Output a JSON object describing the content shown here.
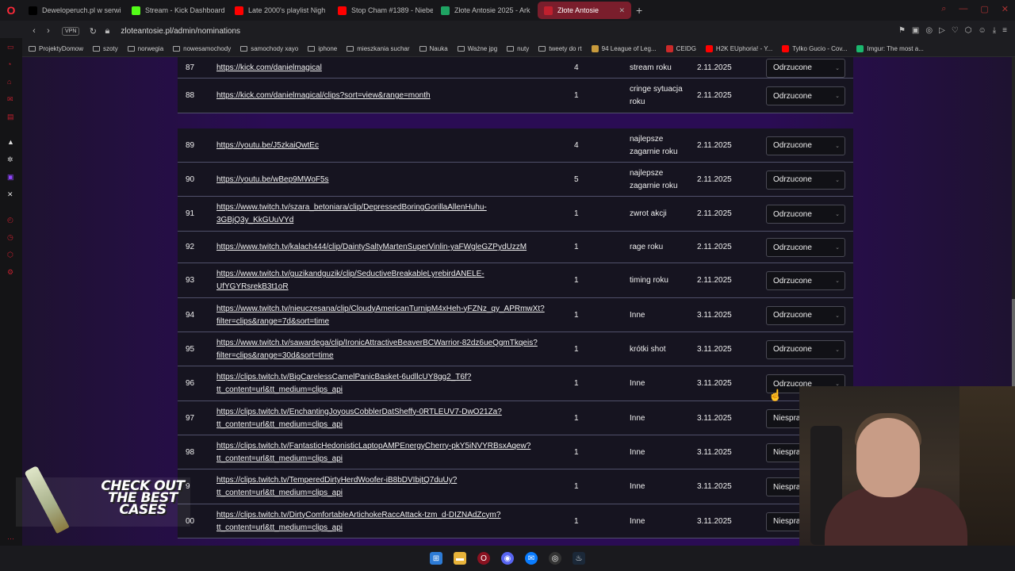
{
  "tabs": [
    {
      "label": "Deweloperuch.pl w serwi",
      "icon": "x-icon",
      "color": "#000000"
    },
    {
      "label": "Stream - Kick Dashboard",
      "icon": "kick-icon",
      "color": "#53fc18"
    },
    {
      "label": "Late 2000's playlist Nigh",
      "icon": "youtube-icon",
      "color": "#ff0000"
    },
    {
      "label": "Stop Cham #1389 - Niebe",
      "icon": "youtube-icon",
      "color": "#ff0000"
    },
    {
      "label": "Złote Antosie 2025 - Ark",
      "icon": "sheets-icon",
      "color": "#1fa463"
    },
    {
      "label": "Złote Antosie",
      "icon": "site-icon",
      "color": "#c0202e"
    }
  ],
  "address": {
    "vpn": "VPN",
    "url": "zloteantosie.pl/admin/nominations"
  },
  "bookmarks": [
    {
      "label": "ProjektyDomow",
      "type": "folder"
    },
    {
      "label": "szoty",
      "type": "folder"
    },
    {
      "label": "norwegia",
      "type": "folder"
    },
    {
      "label": "nowesamochody",
      "type": "folder"
    },
    {
      "label": "samochody xayo",
      "type": "folder"
    },
    {
      "label": "iphone",
      "type": "folder"
    },
    {
      "label": "mieszkania suchar",
      "type": "folder"
    },
    {
      "label": "Nauka",
      "type": "folder"
    },
    {
      "label": "Ważne jpg",
      "type": "folder"
    },
    {
      "label": "nuty",
      "type": "folder"
    },
    {
      "label": "tweety do rt",
      "type": "folder"
    },
    {
      "label": "94 League of Leg...",
      "type": "site",
      "color": "#c89b3c"
    },
    {
      "label": "CEIDG",
      "type": "site",
      "color": "#cc2a2a"
    },
    {
      "label": "H2K EUphoria! - Y...",
      "type": "site",
      "color": "#ff0000"
    },
    {
      "label": "Tylko Gucio - Cov...",
      "type": "site",
      "color": "#ff0000"
    },
    {
      "label": "Imgur: The most a...",
      "type": "site",
      "color": "#1bb76e"
    }
  ],
  "nominations": [
    {
      "id": "87",
      "link": "https://kick.com/danielmagical",
      "link2": "",
      "votes": "4",
      "category": "stream roku",
      "date": "2.11.2025",
      "status": "Odrzucone"
    },
    {
      "id": "88",
      "link": "https://kick.com/danielmagical/clips?sort=view&range=month",
      "link2": "",
      "votes": "1",
      "category": "cringe sytuacja roku",
      "date": "2.11.2025",
      "status": "Odrzucone"
    },
    {
      "id": "89",
      "link": "https://youtu.be/J5zkaiQwtEc",
      "link2": "",
      "votes": "4",
      "category": "najlepsze zagarnie roku",
      "date": "2.11.2025",
      "status": "Odrzucone"
    },
    {
      "id": "90",
      "link": "https://youtu.be/wBep9MWoF5s",
      "link2": "",
      "votes": "5",
      "category": "najlepsze zagarnie roku",
      "date": "2.11.2025",
      "status": "Odrzucone"
    },
    {
      "id": "91",
      "link": "https://www.twitch.tv/szara_betoniara/clip/DepressedBoringGorillaAllenHuhu-",
      "link2": "3GBjQ3y_KkGUuVYd",
      "votes": "1",
      "category": "zwrot akcji",
      "date": "2.11.2025",
      "status": "Odrzucone"
    },
    {
      "id": "92",
      "link": "https://www.twitch.tv/kalach444/clip/DaintySaltyMartenSuperVinlin-yaFWgleGZPydUzzM",
      "link2": "",
      "votes": "1",
      "category": "rage roku",
      "date": "2.11.2025",
      "status": "Odrzucone"
    },
    {
      "id": "93",
      "link": "https://www.twitch.tv/guzikandguzik/clip/SeductiveBreakableLyrebirdANELE-",
      "link2": "UfYGYRsrekB3t1oR",
      "votes": "1",
      "category": "timing roku",
      "date": "2.11.2025",
      "status": "Odrzucone"
    },
    {
      "id": "94",
      "link": "https://www.twitch.tv/nieuczesana/clip/CloudyAmericanTurnipM4xHeh-yFZNz_qy_APRmwXt?",
      "link2": "filter=clips&range=7d&sort=time",
      "votes": "1",
      "category": "Inne",
      "date": "3.11.2025",
      "status": "Odrzucone"
    },
    {
      "id": "95",
      "link": "https://www.twitch.tv/sawardega/clip/IronicAttractiveBeaverBCWarrior-82dz6ueQgmTkqeis?",
      "link2": "filter=clips&range=30d&sort=time",
      "votes": "1",
      "category": "krótki shot",
      "date": "3.11.2025",
      "status": "Odrzucone"
    },
    {
      "id": "96",
      "link": "https://clips.twitch.tv/BigCarelessCamelPanicBasket-6udllcUY8gg2_T6f?",
      "link2": "tt_content=url&tt_medium=clips_api",
      "votes": "1",
      "category": "Inne",
      "date": "3.11.2025",
      "status": "Odrzucone"
    },
    {
      "id": "97",
      "link": "https://clips.twitch.tv/EnchantingJoyousCobblerDatSheffy-0RTLEUV7-DwO21Za?",
      "link2": "tt_content=url&tt_medium=clips_api",
      "votes": "1",
      "category": "Inne",
      "date": "3.11.2025",
      "status": "Niespra"
    },
    {
      "id": "98",
      "link": "https://clips.twitch.tv/FantasticHedonisticLaptopAMPEnergyCherry-pkY5iNVYRBsxAqew?",
      "link2": "tt_content=url&tt_medium=clips_api",
      "votes": "1",
      "category": "Inne",
      "date": "3.11.2025",
      "status": "Niespra"
    },
    {
      "id": "9",
      "link": "https://clips.twitch.tv/TemperedDirtyHerdWoofer-iB8bDVIbjtQ7duUy?",
      "link2": "tt_content=url&tt_medium=clips_api",
      "votes": "1",
      "category": "Inne",
      "date": "3.11.2025",
      "status": "Niespra"
    },
    {
      "id": "00",
      "link": "https://clips.twitch.tv/DirtyComfortableArtichokeRaccAttack-tzm_d-DIZNAdZcym?",
      "link2": "tt_content=url&tt_medium=clips_api",
      "votes": "1",
      "category": "Inne",
      "date": "3.11.2025",
      "status": "Niespra"
    }
  ],
  "overlay": {
    "case_ad_text": "CHECK OUT THE BEST CASES"
  },
  "taskbar": [
    "windows-start-icon",
    "file-explorer-icon",
    "opera-gx-icon",
    "discord-icon",
    "messenger-icon",
    "obs-icon",
    "steam-icon"
  ],
  "colors": {
    "accent": "#c0202e",
    "page_bg": "#2a0c54",
    "active_tab": "#7a1e2c"
  }
}
